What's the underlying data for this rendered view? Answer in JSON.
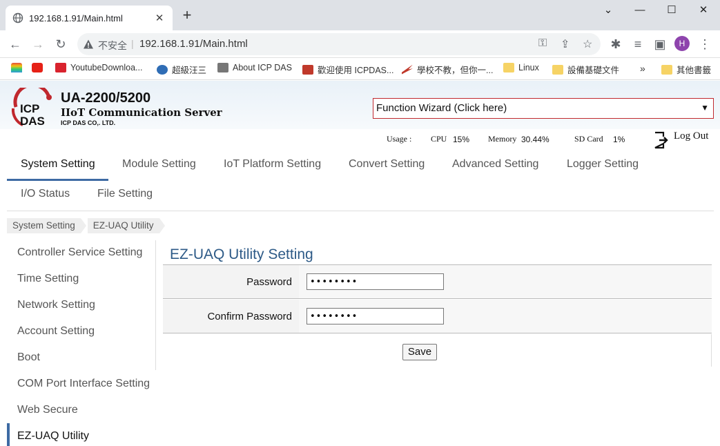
{
  "browser": {
    "tab_title": "192.168.1.91/Main.html",
    "tab_close": "✕",
    "new_tab": "+",
    "security_label": "不安全",
    "separator": "|",
    "url": "192.168.1.91/Main.html",
    "avatar_letter": "H",
    "bookmarks": [
      {
        "label": ""
      },
      {
        "label": ""
      },
      {
        "label": "YoutubeDownloa..."
      },
      {
        "label": "超級汪三"
      },
      {
        "label": "About ICP DAS"
      },
      {
        "label": "歡迎使用 ICPDAS..."
      },
      {
        "label": "學校不教，但你一..."
      },
      {
        "label": "Linux"
      },
      {
        "label": "設備基礎文件"
      },
      {
        "label": "»"
      },
      {
        "label": "其他書籤"
      }
    ]
  },
  "header": {
    "model": "UA-2200/5200",
    "product": "IIoT Communication Server",
    "company": "ICP DAS CO,. LTD.",
    "wizard": "Function Wizard  (Click here)",
    "usage_label": "Usage :",
    "cpu_label": "CPU",
    "cpu_value": "15%",
    "memory_label": "Memory",
    "memory_value": "30.44%",
    "sd_label": "SD Card",
    "sd_value": "1%",
    "logout": "Log Out"
  },
  "nav": {
    "tabs": [
      "System Setting",
      "Module Setting",
      "IoT Platform Setting",
      "Convert Setting",
      "Advanced Setting",
      "Logger Setting",
      "I/O Status",
      "File Setting"
    ],
    "active": "System Setting"
  },
  "breadcrumb": [
    "System Setting",
    "EZ-UAQ Utility"
  ],
  "sidebar": {
    "items": [
      "Controller Service Setting",
      "Time Setting",
      "Network Setting",
      "Account Setting",
      "Boot",
      "COM Port Interface Setting",
      "Web Secure",
      "EZ-UAQ Utility"
    ],
    "active": "EZ-UAQ Utility"
  },
  "form": {
    "title": "EZ-UAQ Utility Setting",
    "password_label": "Password",
    "password_value": "••••••••",
    "confirm_label": "Confirm Password",
    "confirm_value": "••••••••",
    "save_label": "Save"
  },
  "colors": {
    "accent": "#3d6aa3",
    "wizard_border": "#c0282e",
    "title": "#2d5a87"
  }
}
